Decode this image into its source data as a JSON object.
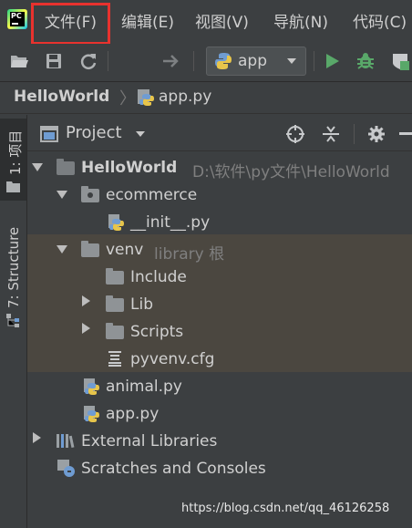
{
  "menu": {
    "logo_text": "PC",
    "items": [
      "文件(F)",
      "编辑(E)",
      "视图(V)",
      "导航(N)",
      "代码(C)"
    ]
  },
  "toolbar": {
    "run_config": "app"
  },
  "breadcrumb": {
    "project": "HelloWorld",
    "file": "app.py"
  },
  "left_strip": {
    "tab1": "1: 项目",
    "tab2": "7: Structure"
  },
  "panel": {
    "title": "Project"
  },
  "tree": {
    "root": {
      "name": "HelloWorld",
      "path": "D:\\软件\\py文件\\HelloWorld"
    },
    "ecommerce": "ecommerce",
    "init": "__init__.py",
    "venv": {
      "name": "venv",
      "hint": "library 根"
    },
    "include": "Include",
    "lib": "Lib",
    "scripts": "Scripts",
    "pyvenv": "pyvenv.cfg",
    "animal": "animal.py",
    "app": "app.py",
    "external": "External Libraries",
    "scratches": "Scratches and Consoles"
  },
  "watermark": "https://blog.csdn.net/qq_46126258",
  "colors": {
    "highlight": "#e8322e",
    "run_green": "#59a869",
    "background": "#3c3f41",
    "venv_bg": "#4b4740"
  }
}
